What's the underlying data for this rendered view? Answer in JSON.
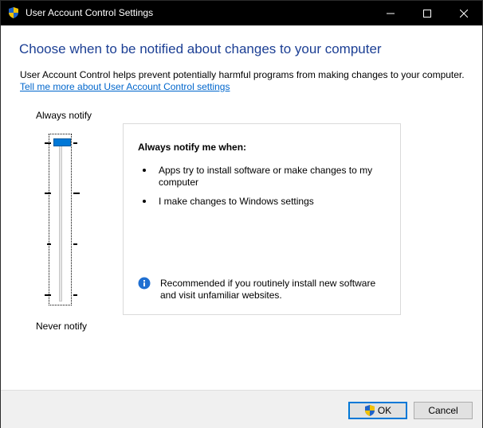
{
  "window": {
    "title": "User Account Control Settings"
  },
  "main": {
    "heading": "Choose when to be notified about changes to your computer",
    "description": "User Account Control helps prevent potentially harmful programs from making changes to your computer.",
    "learn_more_link": "Tell me more about User Account Control settings"
  },
  "slider": {
    "top_label": "Always notify",
    "bottom_label": "Never notify",
    "level": 4,
    "max_level": 4
  },
  "info_panel": {
    "heading": "Always notify me when:",
    "bullets": [
      "Apps try to install software or make changes to my computer",
      "I make changes to Windows settings"
    ],
    "note": "Recommended if you routinely install new software and visit unfamiliar websites."
  },
  "footer": {
    "ok_label": "OK",
    "cancel_label": "Cancel"
  },
  "colors": {
    "accent": "#0078d7",
    "heading": "#1c3f94",
    "link": "#0066cc"
  }
}
